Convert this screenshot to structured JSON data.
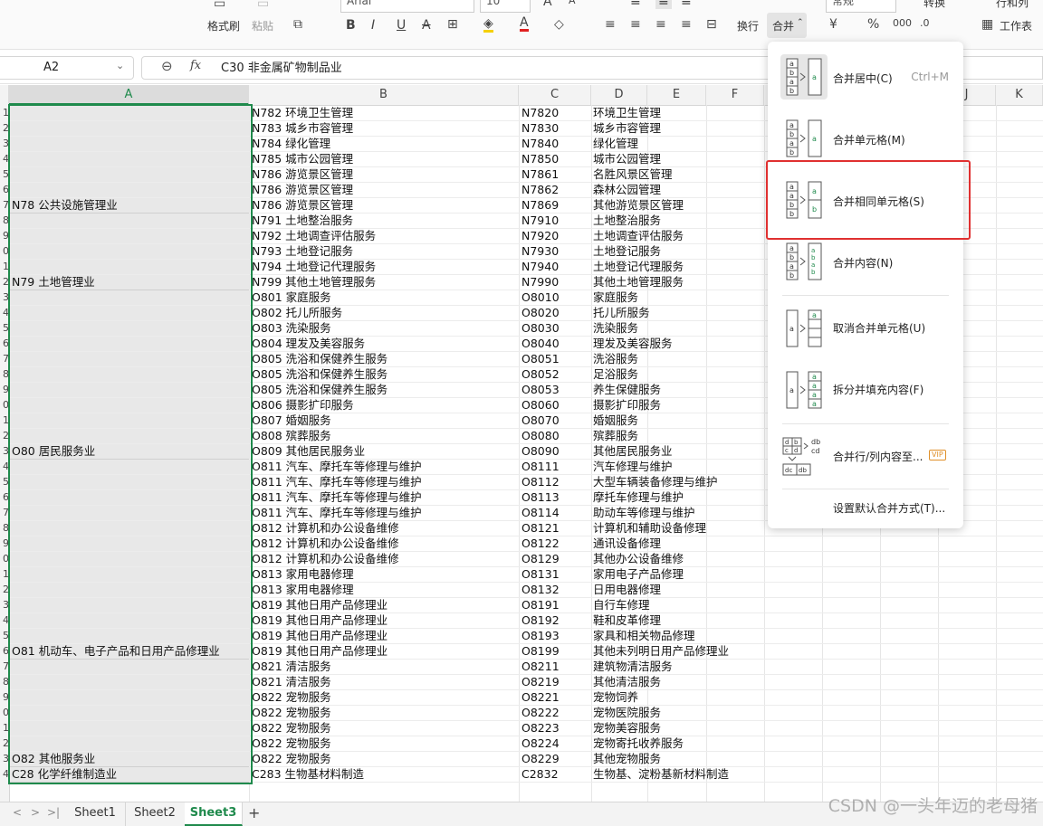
{
  "ribbon": {
    "format_painter": "格式刷",
    "paste": "粘贴",
    "font_name": "Arial",
    "font_size": "10",
    "wrap": "换行",
    "merge": "合并",
    "number_format": "常规",
    "convert": "转换",
    "rows_cols": "行和列",
    "worksheet": "工作表",
    "bold": "B",
    "italic": "I",
    "underline": "U",
    "strike": "A",
    "font_grow": "A",
    "font_shrink": "A",
    "currency": "¥",
    "percent": "%"
  },
  "formula_bar": {
    "name_box": "A2",
    "fx": "fx",
    "formula": "C30  非金属矿物制品业"
  },
  "columns": [
    "A",
    "B",
    "C",
    "D",
    "E",
    "F",
    "",
    "",
    "",
    "J",
    "K"
  ],
  "row_numbers": [
    "1",
    "2",
    "3",
    "4",
    "5",
    "6",
    "7",
    "8",
    "9",
    "0",
    "1",
    "2",
    "3",
    "4",
    "5",
    "6",
    "7",
    "8",
    "9",
    "0",
    "1",
    "2",
    "3",
    "4",
    "5",
    "6",
    "7",
    "8",
    "9",
    "0",
    "1",
    "2",
    "3",
    "4",
    "5",
    "6",
    "7",
    "8",
    "9",
    "0",
    "1",
    "2",
    "3",
    "4",
    ""
  ],
  "rows": [
    {
      "a": "",
      "b": "N782 环境卫生管理",
      "c": "N7820",
      "d": "环境卫生管理"
    },
    {
      "a": "",
      "b": "N783 城乡市容管理",
      "c": "N7830",
      "d": "城乡市容管理"
    },
    {
      "a": "",
      "b": "N784 绿化管理",
      "c": "N7840",
      "d": "绿化管理"
    },
    {
      "a": "",
      "b": "N785 城市公园管理",
      "c": "N7850",
      "d": "城市公园管理"
    },
    {
      "a": "",
      "b": "N786 游览景区管理",
      "c": "N7861",
      "d": "名胜风景区管理"
    },
    {
      "a": "",
      "b": "N786 游览景区管理",
      "c": "N7862",
      "d": "森林公园管理"
    },
    {
      "a": "N78 公共设施管理业",
      "b": "N786 游览景区管理",
      "c": "N7869",
      "d": "其他游览景区管理"
    },
    {
      "a": "",
      "b": "N791 土地整治服务",
      "c": "N7910",
      "d": "土地整治服务"
    },
    {
      "a": "",
      "b": "N792 土地调查评估服务",
      "c": "N7920",
      "d": "土地调查评估服务"
    },
    {
      "a": "",
      "b": "N793 土地登记服务",
      "c": "N7930",
      "d": "土地登记服务"
    },
    {
      "a": "",
      "b": "N794 土地登记代理服务",
      "c": "N7940",
      "d": "土地登记代理服务"
    },
    {
      "a": "N79 土地管理业",
      "b": "N799 其他土地管理服务",
      "c": "N7990",
      "d": "其他土地管理服务"
    },
    {
      "a": "",
      "b": "O801 家庭服务",
      "c": "O8010",
      "d": "家庭服务"
    },
    {
      "a": "",
      "b": "O802 托儿所服务",
      "c": "O8020",
      "d": "托儿所服务"
    },
    {
      "a": "",
      "b": "O803 洗染服务",
      "c": "O8030",
      "d": "洗染服务"
    },
    {
      "a": "",
      "b": "O804 理发及美容服务",
      "c": "O8040",
      "d": "理发及美容服务"
    },
    {
      "a": "",
      "b": "O805 洗浴和保健养生服务",
      "c": "O8051",
      "d": "洗浴服务"
    },
    {
      "a": "",
      "b": "O805 洗浴和保健养生服务",
      "c": "O8052",
      "d": "足浴服务"
    },
    {
      "a": "",
      "b": "O805 洗浴和保健养生服务",
      "c": "O8053",
      "d": "养生保健服务"
    },
    {
      "a": "",
      "b": "O806 摄影扩印服务",
      "c": "O8060",
      "d": "摄影扩印服务"
    },
    {
      "a": "",
      "b": "O807 婚姻服务",
      "c": "O8070",
      "d": "婚姻服务"
    },
    {
      "a": "",
      "b": "O808 殡葬服务",
      "c": "O8080",
      "d": "殡葬服务"
    },
    {
      "a": "O80 居民服务业",
      "b": "O809 其他居民服务业",
      "c": "O8090",
      "d": "其他居民服务业"
    },
    {
      "a": "",
      "b": "O811 汽车、摩托车等修理与维护",
      "c": "O8111",
      "d": "汽车修理与维护"
    },
    {
      "a": "",
      "b": "O811 汽车、摩托车等修理与维护",
      "c": "O8112",
      "d": "大型车辆装备修理与维护"
    },
    {
      "a": "",
      "b": "O811 汽车、摩托车等修理与维护",
      "c": "O8113",
      "d": "摩托车修理与维护"
    },
    {
      "a": "",
      "b": "O811 汽车、摩托车等修理与维护",
      "c": "O8114",
      "d": "助动车等修理与维护"
    },
    {
      "a": "",
      "b": "O812 计算机和办公设备维修",
      "c": "O8121",
      "d": "计算机和辅助设备修理"
    },
    {
      "a": "",
      "b": "O812 计算机和办公设备维修",
      "c": "O8122",
      "d": "通讯设备修理"
    },
    {
      "a": "",
      "b": "O812 计算机和办公设备维修",
      "c": "O8129",
      "d": "其他办公设备维修"
    },
    {
      "a": "",
      "b": "O813 家用电器修理",
      "c": "O8131",
      "d": "家用电子产品修理"
    },
    {
      "a": "",
      "b": "O813 家用电器修理",
      "c": "O8132",
      "d": "日用电器修理"
    },
    {
      "a": "",
      "b": "O819 其他日用产品修理业",
      "c": "O8191",
      "d": "自行车修理"
    },
    {
      "a": "",
      "b": "O819 其他日用产品修理业",
      "c": "O8192",
      "d": "鞋和皮革修理"
    },
    {
      "a": "",
      "b": "O819 其他日用产品修理业",
      "c": "O8193",
      "d": "家具和相关物品修理"
    },
    {
      "a": "O81 机动车、电子产品和日用产品修理业",
      "b": "O819 其他日用产品修理业",
      "c": "O8199",
      "d": "其他未列明日用产品修理业"
    },
    {
      "a": "",
      "b": "O821 清洁服务",
      "c": "O8211",
      "d": "建筑物清洁服务"
    },
    {
      "a": "",
      "b": "O821 清洁服务",
      "c": "O8219",
      "d": "其他清洁服务"
    },
    {
      "a": "",
      "b": "O822 宠物服务",
      "c": "O8221",
      "d": "宠物饲养"
    },
    {
      "a": "",
      "b": "O822 宠物服务",
      "c": "O8222",
      "d": "宠物医院服务"
    },
    {
      "a": "",
      "b": "O822 宠物服务",
      "c": "O8223",
      "d": "宠物美容服务"
    },
    {
      "a": "",
      "b": "O822 宠物服务",
      "c": "O8224",
      "d": "宠物寄托收养服务"
    },
    {
      "a": "O82 其他服务业",
      "b": "O822 宠物服务",
      "c": "O8229",
      "d": "其他宠物服务"
    },
    {
      "a": "C28 化学纤维制造业",
      "b": "C283 生物基材料制造",
      "c": "C2832",
      "d": "生物基、淀粉基新材料制造"
    }
  ],
  "merge_menu": {
    "items": [
      {
        "label": "合并居中(C)",
        "shortcut": "Ctrl+M"
      },
      {
        "label": "合并单元格(M)",
        "shortcut": ""
      },
      {
        "label": "合并相同单元格(S)",
        "shortcut": ""
      },
      {
        "label": "合并内容(N)",
        "shortcut": ""
      },
      {
        "label": "取消合并单元格(U)",
        "shortcut": ""
      },
      {
        "label": "拆分并填充内容(F)",
        "shortcut": ""
      },
      {
        "label": "合并行/列内容至...",
        "shortcut": "",
        "badge": "VIP"
      },
      {
        "label": "设置默认合并方式(T)...",
        "shortcut": ""
      }
    ],
    "highlighted_index": 2,
    "highlight_color": "#e03030"
  },
  "sheet_tabs": [
    "Sheet1",
    "Sheet2",
    "Sheet3"
  ],
  "active_sheet": "Sheet3",
  "accent": "#1f8a4c",
  "watermark": "CSDN @一头年迈的老母猪"
}
